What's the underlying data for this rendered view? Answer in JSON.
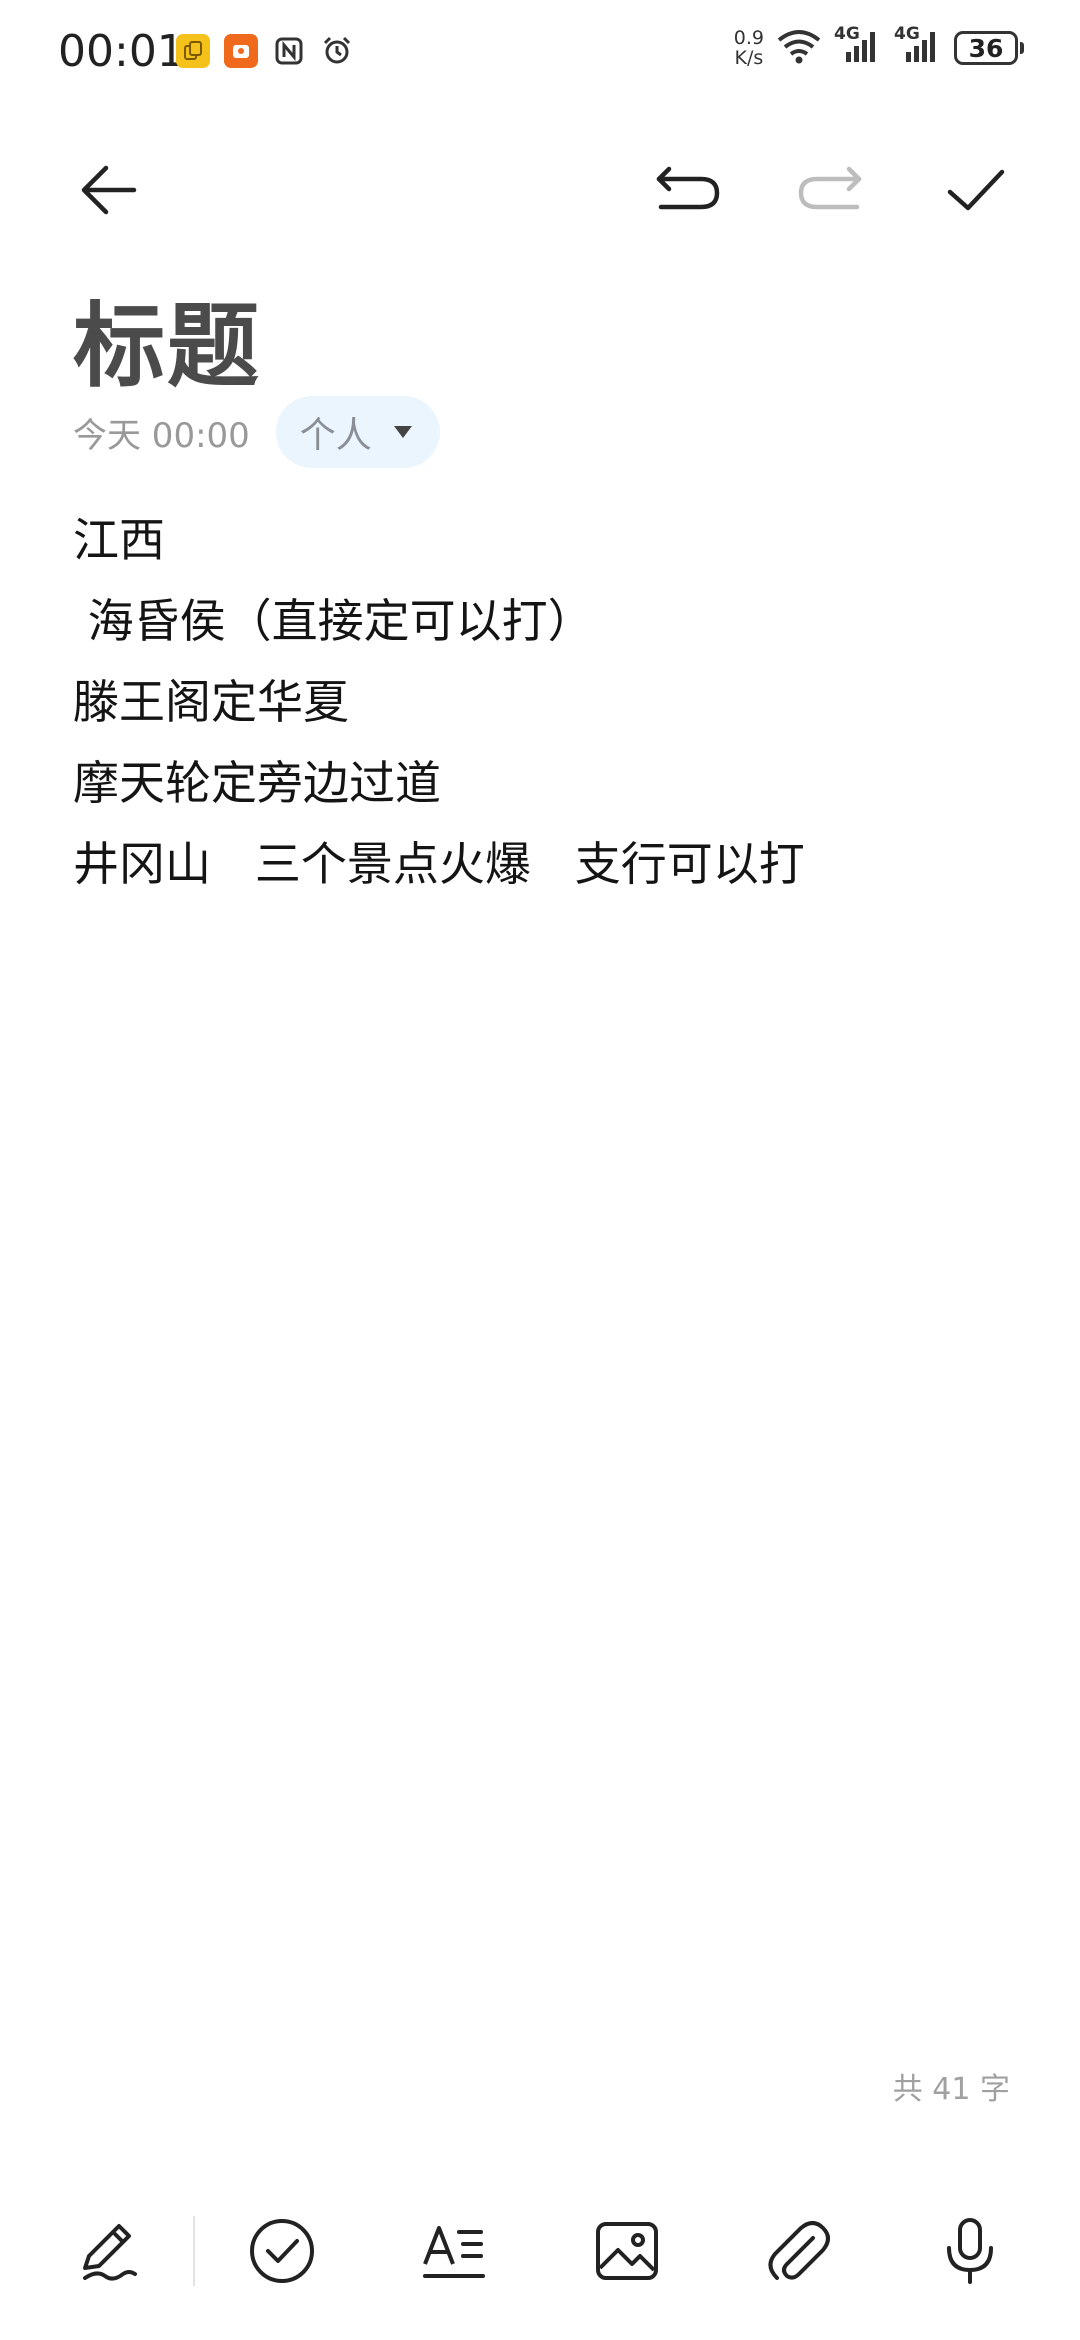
{
  "status_bar": {
    "time": "00:01",
    "net_speed_value": "0.9",
    "net_speed_unit": "K/s",
    "signal1": "4G",
    "signal2": "4G",
    "battery": "36",
    "icons": [
      "clipboard-app-icon",
      "shopping-app-icon",
      "nfc-icon",
      "alarm-icon",
      "wifi-icon",
      "signal-4g-icon",
      "signal-4g-icon",
      "battery-icon"
    ]
  },
  "toolbar": {
    "icons": [
      "back-arrow-icon",
      "undo-icon",
      "redo-icon",
      "check-icon"
    ]
  },
  "note": {
    "title": "标题",
    "date": "今天 00:00",
    "folder": "个人",
    "lines": [
      "江西",
      " 海昏侯（直接定可以打）",
      "滕王阁定华夏",
      "摩天轮定旁边过道",
      "井冈山   三个景点火爆   支行可以打"
    ],
    "word_count": "共 41 字"
  },
  "bottom_bar": {
    "icons": [
      "pen-icon",
      "checklist-icon",
      "text-format-icon",
      "image-icon",
      "attachment-icon",
      "microphone-icon"
    ]
  },
  "colors": {
    "chip_bg": "#eaf5fd",
    "title": "#4b4b4b",
    "muted": "#999999"
  }
}
